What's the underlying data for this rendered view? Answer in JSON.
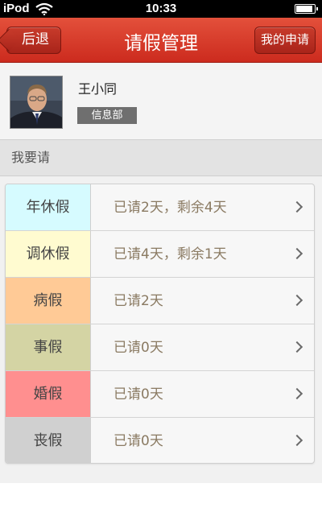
{
  "status_bar": {
    "carrier": "iPod",
    "time": "10:33",
    "icons": [
      "wifi-icon",
      "battery-icon"
    ]
  },
  "nav": {
    "back_label": "后退",
    "title": "请假管理",
    "right_label": "我的申请",
    "bar_color": "#d33a27"
  },
  "profile": {
    "name": "王小同",
    "department": "信息部"
  },
  "section": {
    "title": "我要请"
  },
  "leaves": [
    {
      "type": "年休假",
      "status": "已请2天，剩余4天",
      "color": "#d6fbff"
    },
    {
      "type": "调休假",
      "status": "已请4天，剩余1天",
      "color": "#fffbd0"
    },
    {
      "type": "病假",
      "status": "已请2天",
      "color": "#ffca96"
    },
    {
      "type": "事假",
      "status": "已请0天",
      "color": "#d4d4a4"
    },
    {
      "type": "婚假",
      "status": "已请0天",
      "color": "#ff8f8f"
    },
    {
      "type": "丧假",
      "status": "已请0天",
      "color": "#d0d0d0"
    }
  ]
}
